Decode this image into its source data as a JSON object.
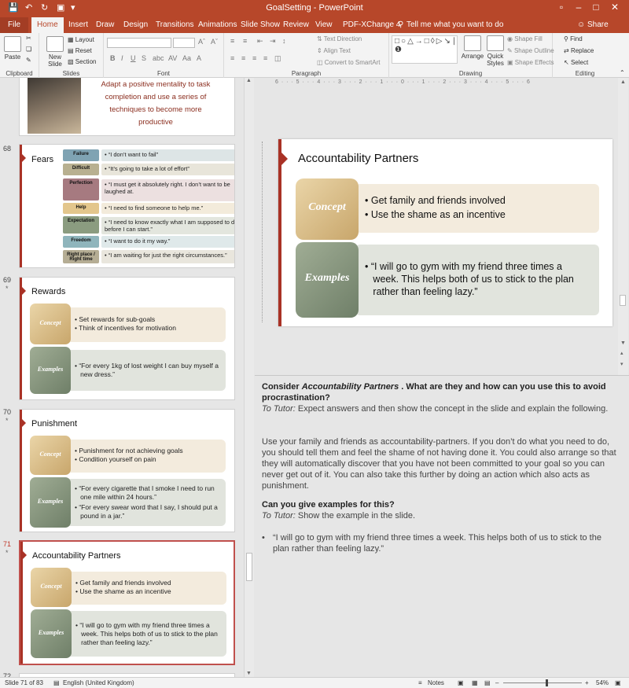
{
  "app": {
    "title": "GoalSetting - PowerPoint",
    "tell_me": "Tell me what you want to do",
    "share": "Share"
  },
  "tabs": [
    "File",
    "Home",
    "Insert",
    "Draw",
    "Design",
    "Transitions",
    "Animations",
    "Slide Show",
    "Review",
    "View",
    "PDF-XChange 4"
  ],
  "ribbon": {
    "clipboard": {
      "label": "Clipboard",
      "paste": "Paste"
    },
    "slides": {
      "label": "Slides",
      "new_slide": "New Slide",
      "layout": "Layout",
      "reset": "Reset",
      "section": "Section"
    },
    "font": {
      "label": "Font"
    },
    "paragraph": {
      "label": "Paragraph",
      "text_direction": "Text Direction",
      "align_text": "Align Text",
      "convert_smartart": "Convert to SmartArt"
    },
    "drawing": {
      "label": "Drawing",
      "arrange": "Arrange",
      "quick_styles": "Quick Styles",
      "shape_fill": "Shape Fill",
      "shape_outline": "Shape Outline",
      "shape_effects": "Shape Effects"
    },
    "editing": {
      "label": "Editing",
      "find": "Find",
      "replace": "Replace",
      "select": "Select"
    }
  },
  "thumbnails": {
    "partial_top": {
      "text": "Adapt a positive mentality to task completion and use a series of techniques to become more productive"
    },
    "slide68": {
      "number": "68",
      "title": "Fears",
      "rows": [
        {
          "label": "Failure",
          "text": "• “I don’t want to fail”",
          "color": "#7fa3b3",
          "band": "#dde5e6"
        },
        {
          "label": "Difficult",
          "text": "• “It’s going to take a lot of effort”",
          "color": "#b8b090",
          "band": "#e8e5da"
        },
        {
          "label": "Perfection",
          "text": "• “I must get it absolutely right. I don’t want to be laughed at.",
          "color": "#a67a80",
          "band": "#ece0e0"
        },
        {
          "label": "Help",
          "text": "• “I need to find someone to help me.”",
          "color": "#e3c68c",
          "band": "#f3ebdb"
        },
        {
          "label": "Expectation",
          "text": "• “I need to know exactly what I am supposed to do before I can start.”",
          "color": "#8b9c80",
          "band": "#e3e6de"
        },
        {
          "label": "Freedom",
          "text": "• “I want to do it my way.”",
          "color": "#8fb5bc",
          "band": "#dfe9ea"
        },
        {
          "label": "Right place / Right time",
          "text": "• “I am waiting for just the right circumstances.”",
          "color": "#b5ad94",
          "band": "#e9e6dd"
        }
      ]
    },
    "slide69": {
      "number": "69",
      "star": "*",
      "title": "Rewards",
      "concept_label": "Concept",
      "examples_label": "Examples",
      "concept_lines": [
        "• Set rewards for sub-goals",
        "• Think of incentives for motivation"
      ],
      "example_lines": [
        "• “For every 1kg of lost weight I can buy myself a",
        "   new dress.”"
      ]
    },
    "slide70": {
      "number": "70",
      "star": "*",
      "title": "Punishment",
      "concept_label": "Concept",
      "examples_label": "Examples",
      "concept_lines": [
        "• Punishment for not achieving goals",
        "• Condition yourself on pain"
      ],
      "example_lines": [
        "• “For every cigarette that I smoke I need to run",
        "   one mile within 24 hours.”",
        "• “For every swear word that I say, I should put a",
        "   pound in a jar.”"
      ]
    },
    "slide71": {
      "number": "71",
      "star": "*",
      "title": "Accountability Partners",
      "concept_label": "Concept",
      "examples_label": "Examples",
      "concept_lines": [
        "• Get family and friends involved",
        "• Use the shame as an incentive"
      ],
      "example_lines": [
        "• “I will go to gym with my friend three times a",
        "   week. This helps both of us to stick to the plan",
        "   rather than feeling lazy.”"
      ]
    },
    "slide72": {
      "number": "72"
    }
  },
  "main_slide": {
    "title": "Accountability Partners",
    "concept_label": "Concept",
    "examples_label": "Examples",
    "concept_lines": [
      "• Get family and friends involved",
      "• Use the shame as an incentive"
    ],
    "example_lines": [
      "• “I will go to gym with my friend three times a",
      "   week. This helps both of us to stick to the plan",
      "   rather than feeling lazy.”"
    ]
  },
  "ruler_text": "6 · · · 5 · · · 4 · · · 3 · · · 2 · · · 1 · · · 0 · · · 1 · · · 2 · · · 3 · · · 4 · · · 5 · · · 6",
  "notes": {
    "q1_prefix": "Consider ",
    "q1_em": "Accountability Partners",
    "q1_rest": " . What are they and how can you use this to avoid procrastination?",
    "tutor_label": "To Tutor:",
    "tutor1": " Expect answers and then show the concept in the slide and explain the following.",
    "para1": "Use your family and friends as accountability-partners. If you don’t do what you need to do, you should tell them and feel the shame of not having done it. You could also arrange so that they will automatically discover that you have not been committed to your goal so you can never get out of it. You can also take this further by doing an action which also acts as punishment.",
    "q2": "Can you give examples for this?",
    "tutor2": " Show the example in the slide.",
    "bullet": "“I will go to gym with my friend three times a week. This helps both of us to stick to the plan rather than feeling lazy.”"
  },
  "status": {
    "slide_info": "Slide 71 of 83",
    "language": "English (United Kingdom)",
    "notes": "Notes",
    "zoom": "54%"
  }
}
